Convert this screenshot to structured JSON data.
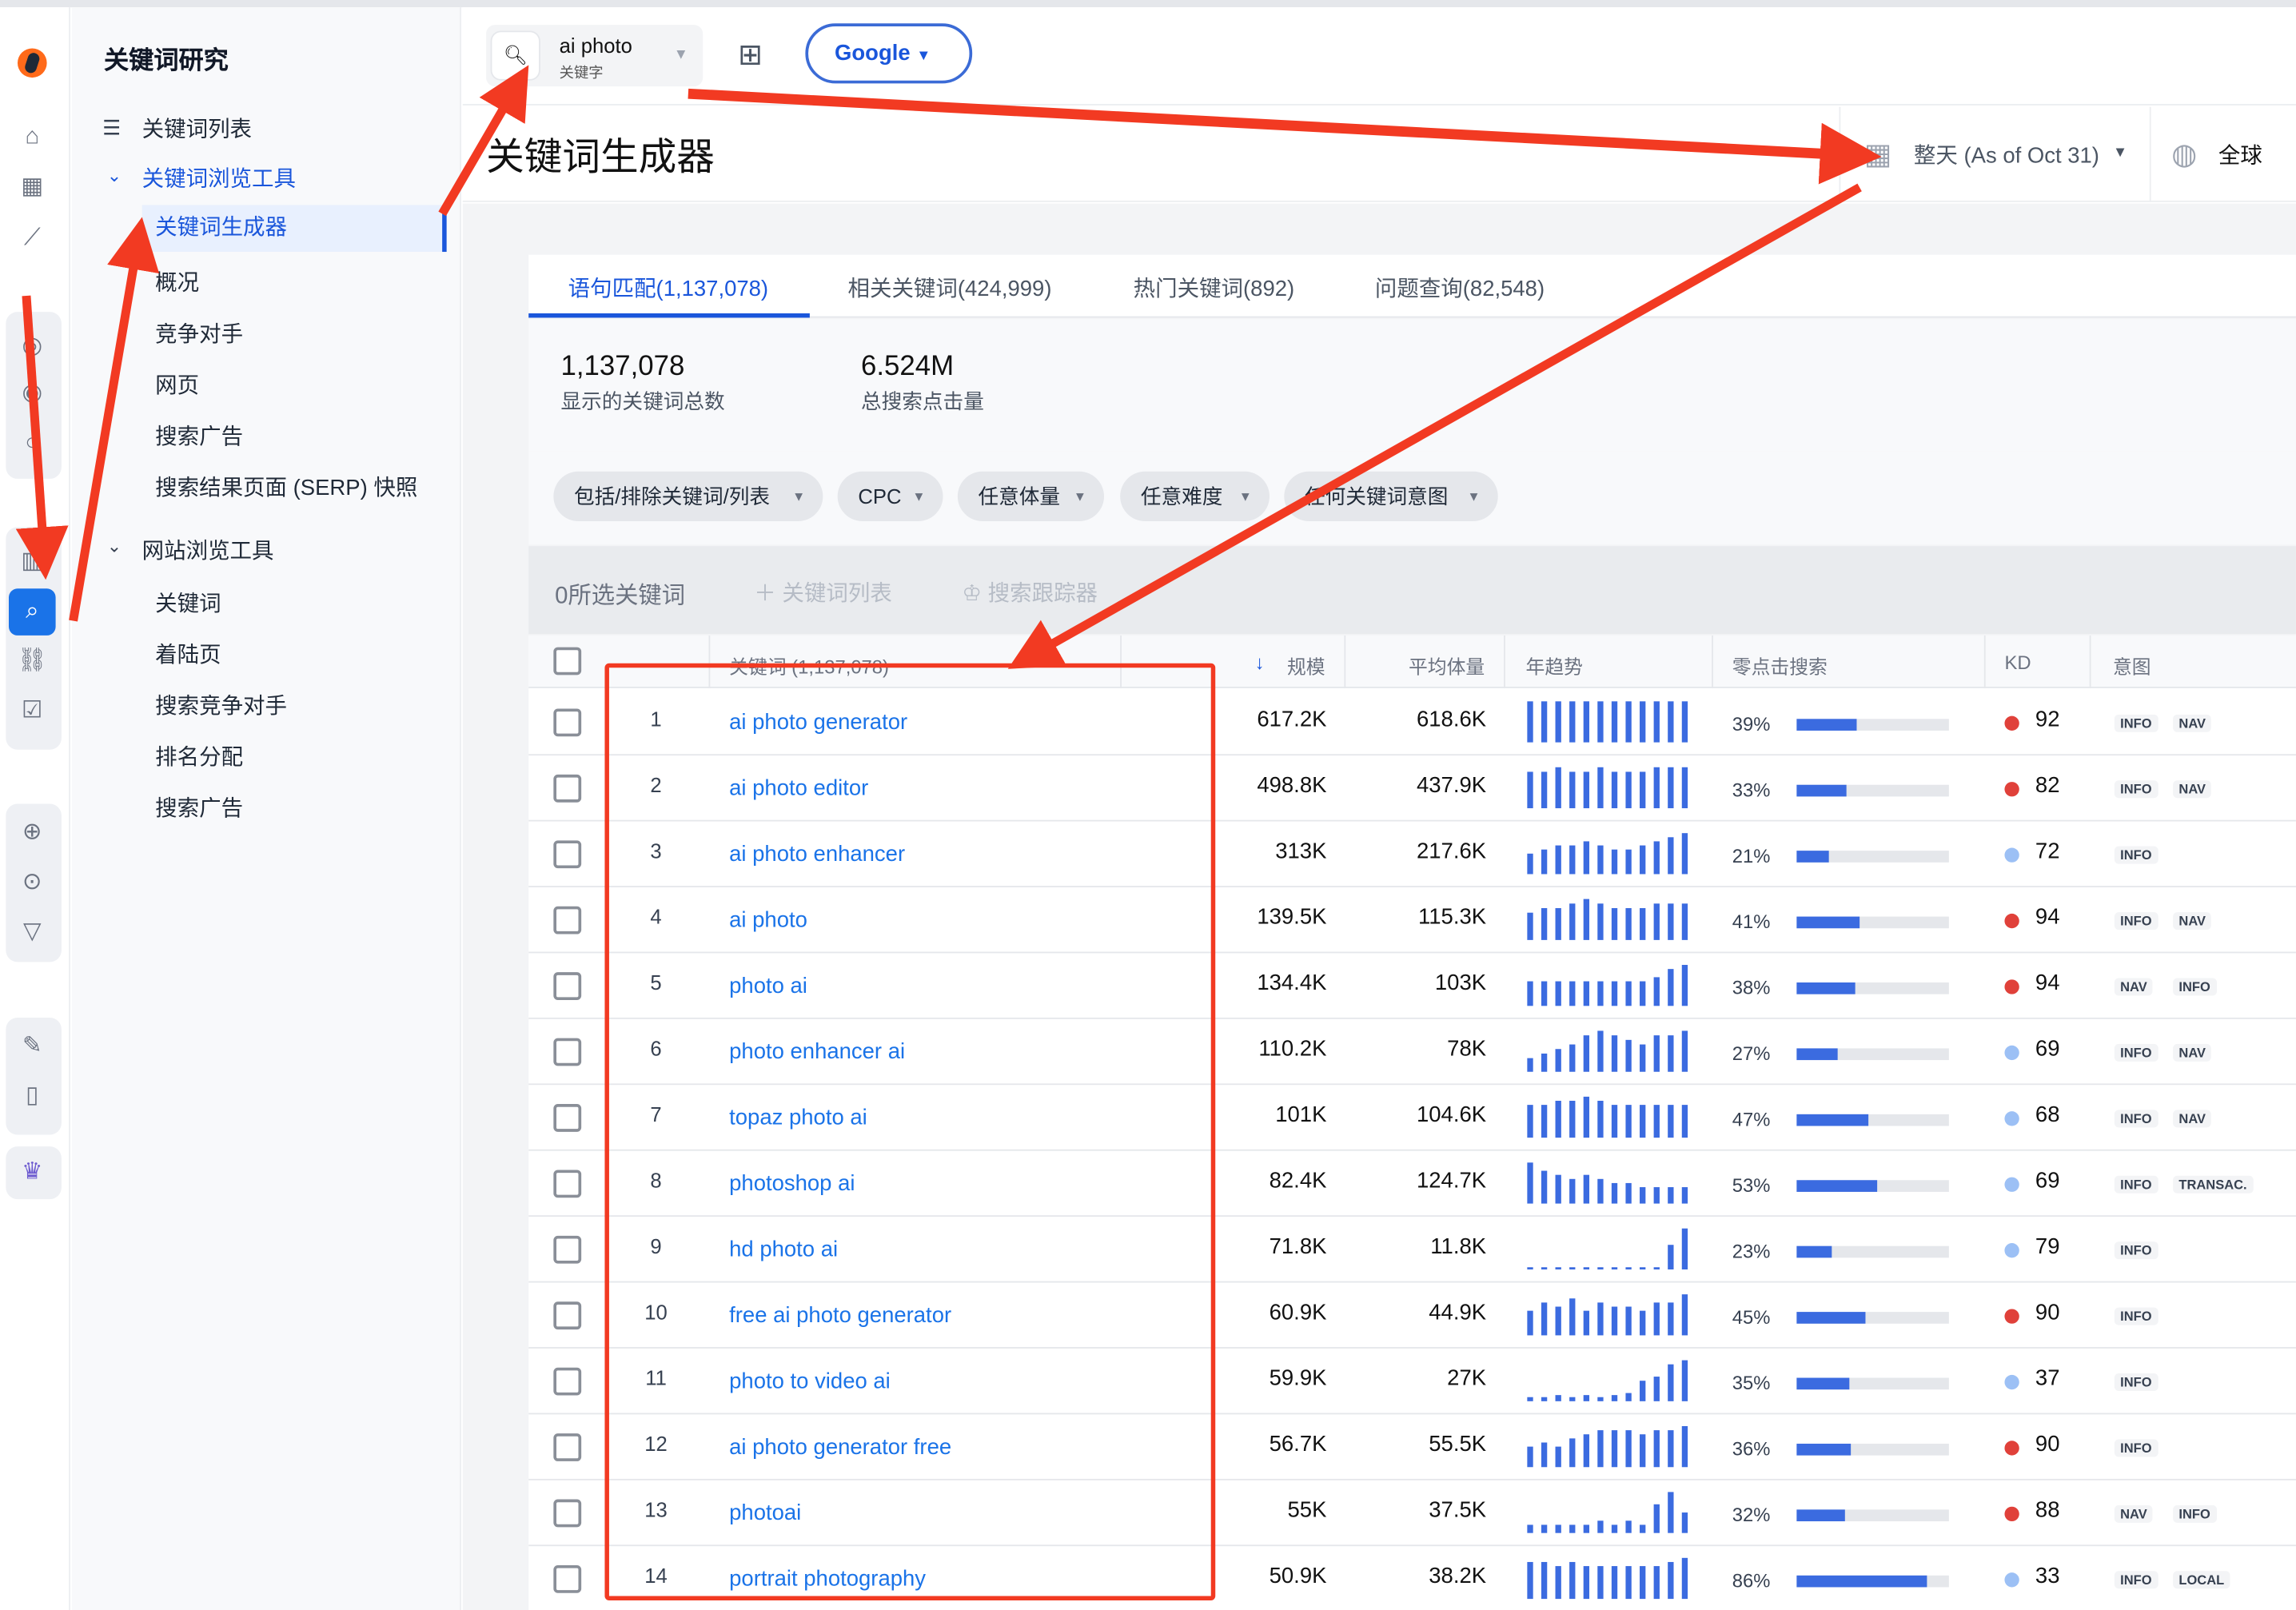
{
  "sidebar": {
    "title": "关键词研究",
    "items": [
      {
        "label": "关键词列表"
      },
      {
        "label": "关键词浏览工具"
      },
      {
        "label": "关键词生成器"
      },
      {
        "label": "概况"
      },
      {
        "label": "竞争对手"
      },
      {
        "label": "网页"
      },
      {
        "label": "搜索广告"
      },
      {
        "label": "搜索结果页面 (SERP) 快照"
      },
      {
        "label": "网站浏览工具"
      },
      {
        "label": "关键词"
      },
      {
        "label": "着陆页"
      },
      {
        "label": "搜索竞争对手"
      },
      {
        "label": "排名分配"
      },
      {
        "label": "搜索广告"
      }
    ]
  },
  "rail_icons": [
    "logo-icon",
    "home-icon",
    "dashboard-icon",
    "chart-icon",
    "globe-icon",
    "target-icon",
    "bar-chart-icon",
    "keyword-search-icon",
    "link-icon",
    "checklist-icon",
    "web-icon",
    "search-circle-icon",
    "filter-icon",
    "report-icon",
    "mobile-icon",
    "crown-icon"
  ],
  "search": {
    "keyword": "ai photo",
    "sublabel": "关键字"
  },
  "engine": "Google",
  "header": {
    "title": "关键词生成器",
    "date": "整天 (As of Oct 31)",
    "geo": "全球"
  },
  "tabs": [
    {
      "label": "语句匹配(1,137,078)"
    },
    {
      "label": "相关关键词(424,999)"
    },
    {
      "label": "热门关键词(892)"
    },
    {
      "label": "问题查询(82,548)"
    }
  ],
  "stats": [
    {
      "value": "1,137,078",
      "label": "显示的关键词总数"
    },
    {
      "value": "6.524M",
      "label": "总搜索点击量"
    }
  ],
  "filters": [
    {
      "label": "包括/排除关键词/列表"
    },
    {
      "label": "CPC"
    },
    {
      "label": "任意体量"
    },
    {
      "label": "任意难度"
    },
    {
      "label": "任何关键词意图"
    }
  ],
  "selection": {
    "count_label": "0所选关键词",
    "add_list": "关键词列表",
    "tracker": "搜索跟踪器"
  },
  "columns": {
    "keyword": "关键词 (1,137,078)",
    "volume": "规模",
    "avg": "平均体量",
    "trend": "年趋势",
    "zero_click": "零点击搜索",
    "kd": "KD",
    "intent": "意图"
  },
  "colors": {
    "accent": "#1a56db",
    "kd_hard": "#e0413a",
    "kd_easy": "#9cc0f5",
    "annotation": "#f23a22"
  },
  "rows": [
    {
      "num": "1",
      "keyword": "ai photo generator",
      "volume": "617.2K",
      "avg": "618.6K",
      "zero": "39%",
      "zero_frac": 0.39,
      "kd": "92",
      "kd_level": "hard",
      "intent": [
        "INFO",
        "NAV"
      ],
      "trend": [
        9,
        9,
        9,
        9,
        9,
        9,
        9,
        9,
        9,
        9,
        9,
        9
      ]
    },
    {
      "num": "2",
      "keyword": "ai photo editor",
      "volume": "498.8K",
      "avg": "437.9K",
      "zero": "33%",
      "zero_frac": 0.33,
      "kd": "82",
      "kd_level": "hard",
      "intent": [
        "INFO",
        "NAV"
      ],
      "trend": [
        8,
        8,
        9,
        8,
        8,
        9,
        8,
        8,
        8,
        9,
        9,
        9
      ]
    },
    {
      "num": "3",
      "keyword": "ai photo enhancer",
      "volume": "313K",
      "avg": "217.6K",
      "zero": "21%",
      "zero_frac": 0.21,
      "kd": "72",
      "kd_level": "easy",
      "intent": [
        "INFO"
      ],
      "trend": [
        5,
        6,
        7,
        7,
        8,
        7,
        6,
        6,
        7,
        8,
        9,
        10
      ]
    },
    {
      "num": "4",
      "keyword": "ai photo",
      "volume": "139.5K",
      "avg": "115.3K",
      "zero": "41%",
      "zero_frac": 0.41,
      "kd": "94",
      "kd_level": "hard",
      "intent": [
        "INFO",
        "NAV"
      ],
      "trend": [
        6,
        7,
        7,
        8,
        9,
        8,
        7,
        7,
        7,
        8,
        8,
        8
      ]
    },
    {
      "num": "5",
      "keyword": "photo ai",
      "volume": "134.4K",
      "avg": "103K",
      "zero": "38%",
      "zero_frac": 0.38,
      "kd": "94",
      "kd_level": "hard",
      "intent": [
        "NAV",
        "INFO"
      ],
      "trend": [
        6,
        6,
        6,
        6,
        6,
        6,
        6,
        6,
        6,
        7,
        9,
        10
      ]
    },
    {
      "num": "6",
      "keyword": "photo enhancer ai",
      "volume": "110.2K",
      "avg": "78K",
      "zero": "27%",
      "zero_frac": 0.27,
      "kd": "69",
      "kd_level": "easy",
      "intent": [
        "INFO",
        "NAV"
      ],
      "trend": [
        3,
        4,
        5,
        6,
        8,
        9,
        8,
        7,
        6,
        8,
        8,
        9
      ]
    },
    {
      "num": "7",
      "keyword": "topaz photo ai",
      "volume": "101K",
      "avg": "104.6K",
      "zero": "47%",
      "zero_frac": 0.47,
      "kd": "68",
      "kd_level": "easy",
      "intent": [
        "INFO",
        "NAV"
      ],
      "trend": [
        8,
        8,
        9,
        9,
        10,
        9,
        8,
        8,
        8,
        8,
        8,
        8
      ]
    },
    {
      "num": "8",
      "keyword": "photoshop ai",
      "volume": "82.4K",
      "avg": "124.7K",
      "zero": "53%",
      "zero_frac": 0.53,
      "kd": "69",
      "kd_level": "easy",
      "intent": [
        "INFO",
        "TRANSAC."
      ],
      "trend": [
        10,
        8,
        7,
        6,
        7,
        6,
        5,
        5,
        4,
        4,
        4,
        4
      ]
    },
    {
      "num": "9",
      "keyword": "hd photo ai",
      "volume": "71.8K",
      "avg": "11.8K",
      "zero": "23%",
      "zero_frac": 0.23,
      "kd": "79",
      "kd_level": "easy",
      "intent": [
        "INFO"
      ],
      "trend": [
        0.4,
        0.4,
        0.4,
        0.4,
        0.4,
        0.4,
        0.4,
        0.4,
        0.4,
        0.4,
        6,
        10
      ]
    },
    {
      "num": "10",
      "keyword": "free ai photo generator",
      "volume": "60.9K",
      "avg": "44.9K",
      "zero": "45%",
      "zero_frac": 0.45,
      "kd": "90",
      "kd_level": "hard",
      "intent": [
        "INFO"
      ],
      "trend": [
        6,
        8,
        7,
        9,
        6,
        8,
        7,
        7,
        6,
        8,
        8,
        10
      ]
    },
    {
      "num": "11",
      "keyword": "photo to video ai",
      "volume": "59.9K",
      "avg": "27K",
      "zero": "35%",
      "zero_frac": 0.35,
      "kd": "37",
      "kd_level": "easy",
      "intent": [
        "INFO"
      ],
      "trend": [
        1,
        1,
        1.5,
        1,
        1.5,
        1,
        1.5,
        2,
        5,
        6,
        9,
        10
      ]
    },
    {
      "num": "12",
      "keyword": "ai photo generator free",
      "volume": "56.7K",
      "avg": "55.5K",
      "zero": "36%",
      "zero_frac": 0.36,
      "kd": "90",
      "kd_level": "hard",
      "intent": [
        "INFO"
      ],
      "trend": [
        5,
        6,
        5,
        7,
        8,
        9,
        9,
        9,
        8,
        9,
        9,
        10
      ]
    },
    {
      "num": "13",
      "keyword": "photoai",
      "volume": "55K",
      "avg": "37.5K",
      "zero": "32%",
      "zero_frac": 0.32,
      "kd": "88",
      "kd_level": "hard",
      "intent": [
        "NAV",
        "INFO"
      ],
      "trend": [
        2,
        2,
        2,
        2,
        2,
        3,
        2,
        3,
        2,
        7,
        10,
        5
      ]
    },
    {
      "num": "14",
      "keyword": "portrait photography",
      "volume": "50.9K",
      "avg": "38.2K",
      "zero": "86%",
      "zero_frac": 0.86,
      "kd": "33",
      "kd_level": "easy",
      "intent": [
        "INFO",
        "LOCAL"
      ],
      "trend": [
        9,
        9,
        8,
        9,
        8,
        8,
        8,
        8,
        8,
        8,
        9,
        10
      ]
    }
  ]
}
